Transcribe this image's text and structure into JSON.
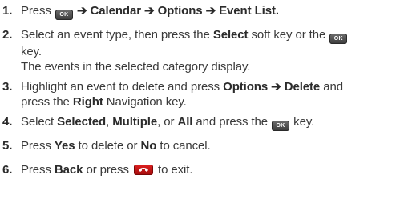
{
  "steps": [
    {
      "number": "1.",
      "t1": "Press",
      "ok_key_label": "OK",
      "arrow": "➔",
      "path1": "Calendar",
      "path2": "Options",
      "path3": "Event List."
    },
    {
      "number": "2.",
      "t1": "Select an event type, then press the",
      "b1": "Select",
      "t2": "soft key or the",
      "ok_key_label": "OK",
      "t3": "key.",
      "note": "The events in the selected category display."
    },
    {
      "number": "3.",
      "t1": "Highlight an event to delete and press",
      "b1": "Options",
      "arrow": "➔",
      "b2": "Delete",
      "t2": "and",
      "t3": "press the",
      "b3": "Right",
      "t4": "Navigation key."
    },
    {
      "number": "4.",
      "t1": "Select",
      "b1": "Selected",
      "t2": ",",
      "b2": "Multiple",
      "t3": ", or",
      "b3": "All",
      "t4": "and press the",
      "ok_key_label": "OK",
      "t5": "key."
    },
    {
      "number": "5.",
      "t1": "Press",
      "b1": "Yes",
      "t2": "to delete or",
      "b2": "No",
      "t3": "to cancel."
    },
    {
      "number": "6.",
      "t1": "Press",
      "b1": "Back",
      "t2": "or press",
      "end_key_icon": "end-call-key-icon",
      "t3": "to exit."
    }
  ],
  "colors": {
    "text": "#3a3a3a",
    "ok_key": "#4a4a4a",
    "end_key": "#c41414"
  }
}
